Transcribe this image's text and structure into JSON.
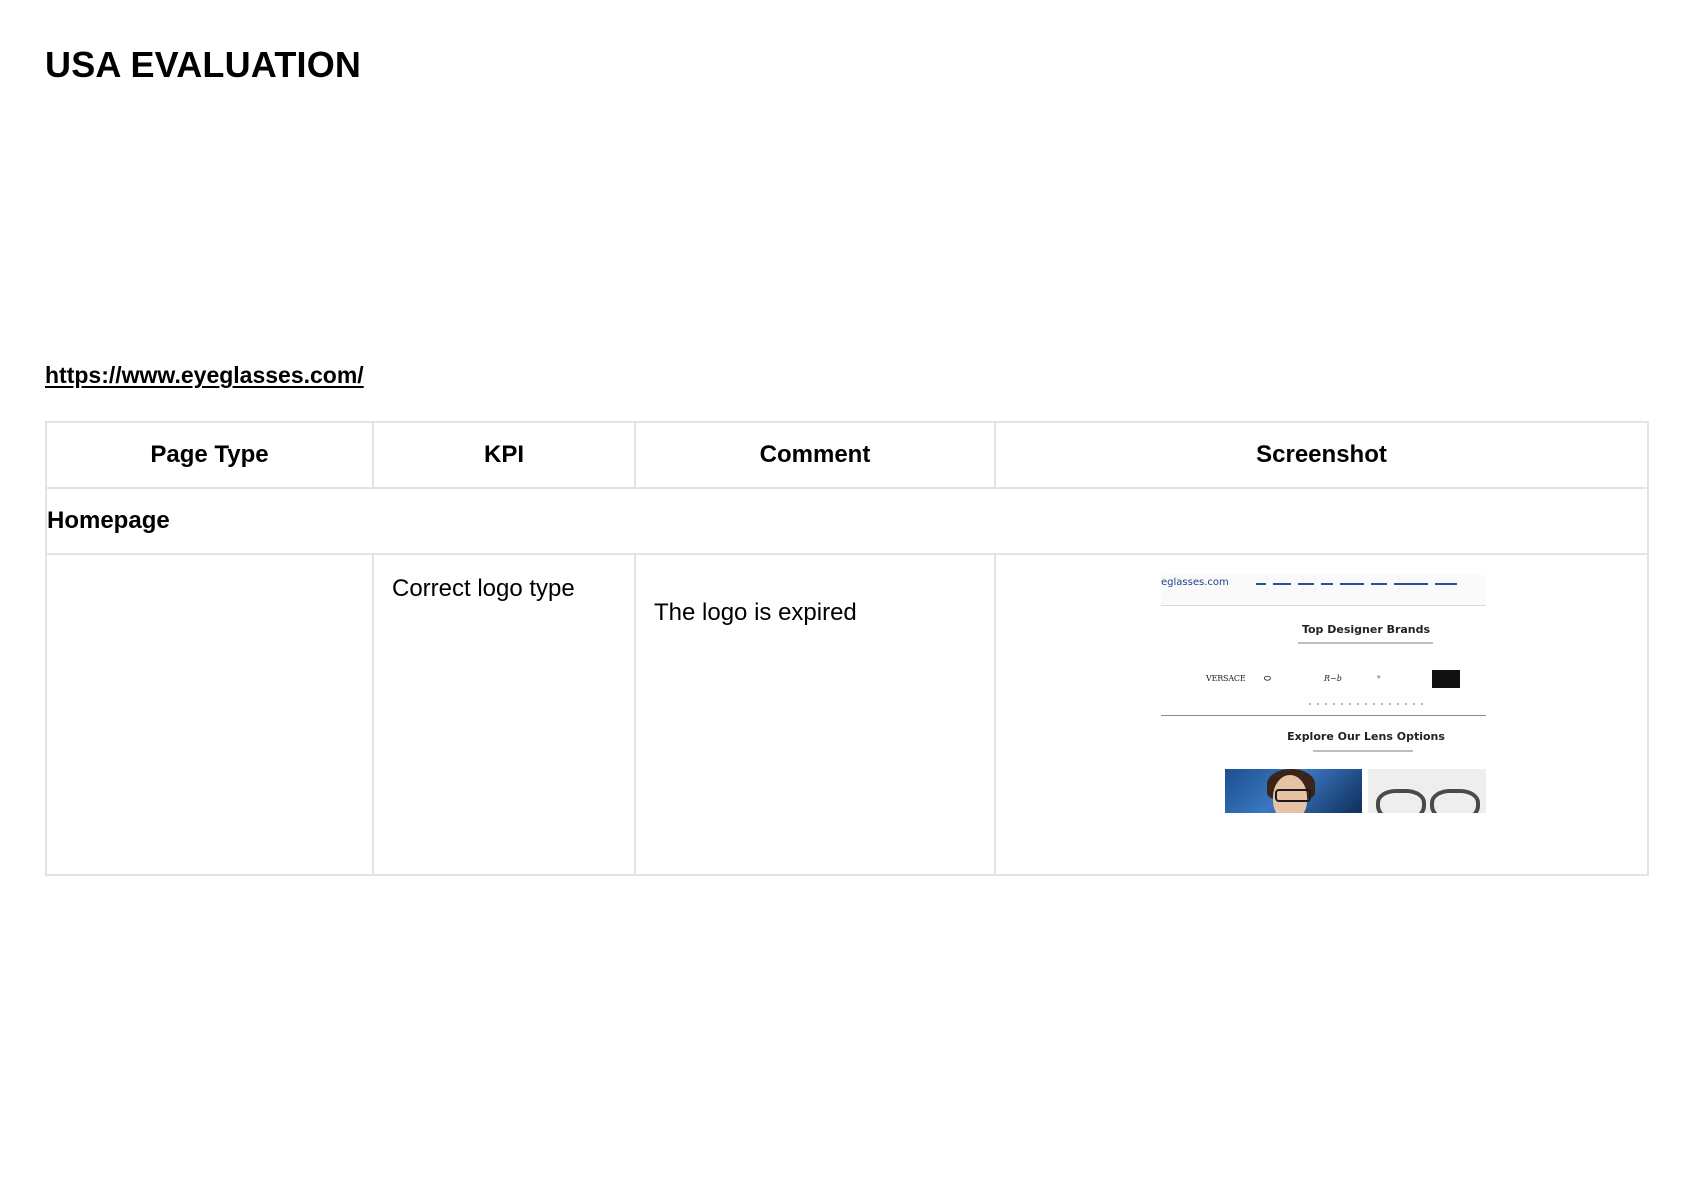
{
  "document": {
    "title": "USA EVALUATION",
    "url": "https://www.eyeglasses.com/"
  },
  "table": {
    "headers": [
      "Page Type",
      "KPI",
      "Comment",
      "Screenshot"
    ],
    "section": "Homepage",
    "rows": [
      {
        "page_type": "",
        "kpi": "Correct logo type",
        "comment": "The logo is expired"
      }
    ]
  },
  "screenshot_thumbnail": {
    "logo_text": "eglasses.com",
    "heading": "Top Designer Brands",
    "brands": [
      "VERSACE",
      "OAKLEY",
      "Ray-Ban",
      "SOLSTICE",
      "Eyeglasses Vintage"
    ],
    "heading2": "Explore Our Lens Options"
  }
}
